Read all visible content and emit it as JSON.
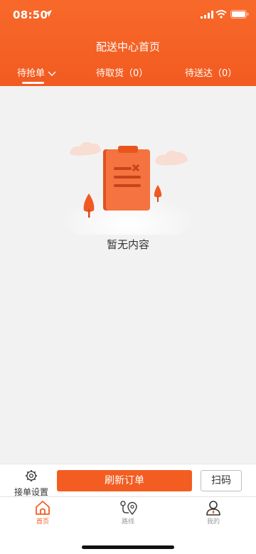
{
  "status_bar": {
    "time": "08:50"
  },
  "header": {
    "title": "配送中心首页",
    "tabs": [
      {
        "label": "待抢单",
        "active": true,
        "has_dropdown": true
      },
      {
        "label": "待取货（0）",
        "active": false
      },
      {
        "label": "待送达（0）",
        "active": false
      }
    ]
  },
  "empty_state": {
    "text": "暂无内容",
    "icon": "clipboard-empty-illustration"
  },
  "action_bar": {
    "settings_label": "接单设置",
    "refresh_label": "刷新订单",
    "scan_label": "扫码"
  },
  "bottom_nav": {
    "items": [
      {
        "label": "首页",
        "icon": "home-icon",
        "active": true
      },
      {
        "label": "路线",
        "icon": "route-icon",
        "active": false
      },
      {
        "label": "我的",
        "icon": "user-icon",
        "active": false
      }
    ]
  },
  "colors": {
    "accent": "#f35d22",
    "header_bg": "#f8692a",
    "page_bg": "#f2f2f2",
    "inactive_nav": "#9a9a9a"
  }
}
